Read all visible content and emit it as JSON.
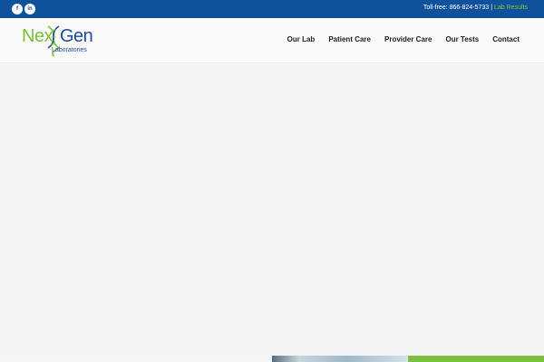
{
  "topbar": {
    "social": [
      {
        "icon": "facebook-icon",
        "glyph": "f"
      },
      {
        "icon": "linkedin-icon",
        "glyph": "in"
      }
    ],
    "tollfree_label": "Toll-free: 866-824-5733",
    "separator": "|",
    "lab_results_link": "Lab Results"
  },
  "logo": {
    "nex": "Nex",
    "gen": "Gen",
    "sub": "Laboratories"
  },
  "nav": {
    "items": [
      "Our Lab",
      "Patient Care",
      "Provider Care",
      "Our Tests",
      "Contact"
    ]
  },
  "colors": {
    "topbar": "#0f519b",
    "accent_green": "#7cbf3d",
    "brand_blue": "#1d4e9a"
  }
}
